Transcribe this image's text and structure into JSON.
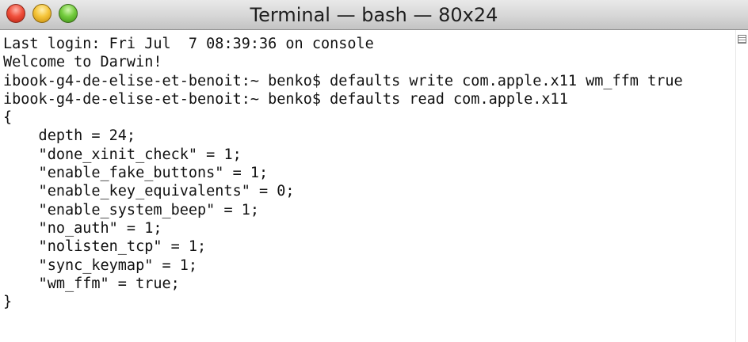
{
  "window": {
    "title": "Terminal — bash — 80x24"
  },
  "terminal": {
    "lines": [
      "Last login: Fri Jul  7 08:39:36 on console",
      "Welcome to Darwin!",
      "ibook-g4-de-elise-et-benoit:~ benko$ defaults write com.apple.x11 wm_ffm true",
      "ibook-g4-de-elise-et-benoit:~ benko$ defaults read com.apple.x11",
      "{",
      "    depth = 24;",
      "    \"done_xinit_check\" = 1;",
      "    \"enable_fake_buttons\" = 1;",
      "    \"enable_key_equivalents\" = 0;",
      "    \"enable_system_beep\" = 1;",
      "    \"no_auth\" = 1;",
      "    \"nolisten_tcp\" = 1;",
      "    \"sync_keymap\" = 1;",
      "    \"wm_ffm\" = true;",
      "}"
    ]
  },
  "icons": {
    "close": "close-button",
    "minimize": "minimize-button",
    "zoom": "zoom-button",
    "splitter": "split-pane-icon"
  },
  "colors": {
    "close": "#f0503c",
    "minimize": "#f5c53a",
    "zoom": "#74cc3e",
    "terminal_background": "#ffffff",
    "terminal_text": "#111111"
  }
}
